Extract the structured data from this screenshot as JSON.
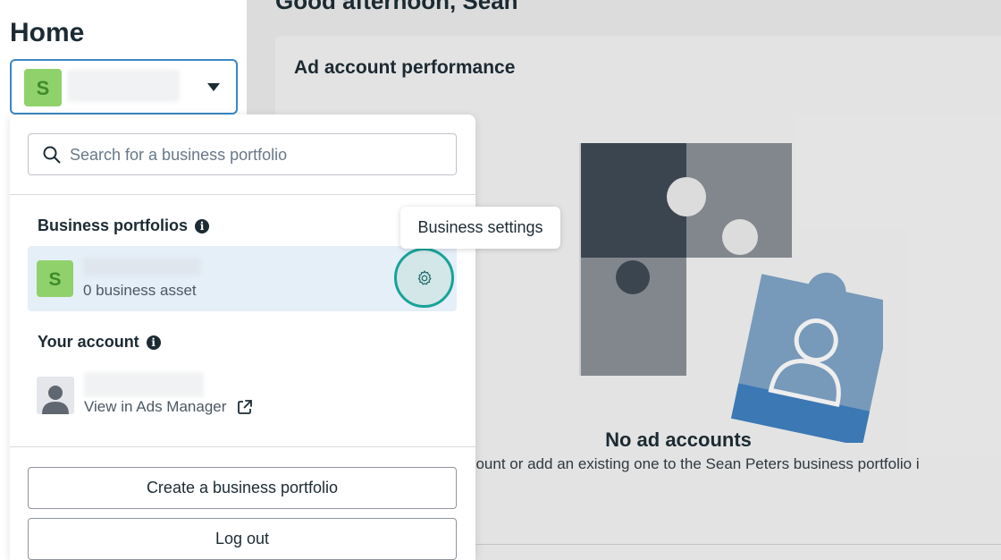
{
  "sidebar": {
    "title": "Home",
    "selected_portfolio_initial": "S"
  },
  "main": {
    "greeting": "Good afternoon, Sean",
    "card_title": "Ad account performance",
    "empty_title": "No ad accounts",
    "empty_description": "account or add an existing one to the Sean Peters business portfolio i"
  },
  "dropdown": {
    "search_placeholder": "Search for a business portfolio",
    "business_portfolios_label": "Business portfolios",
    "portfolio": {
      "initial": "S",
      "asset_count": "0 business asset"
    },
    "your_account_label": "Your account",
    "view_in_ads_manager": "View in Ads Manager",
    "create_button": "Create a business portfolio",
    "logout_button": "Log out"
  },
  "tooltip": {
    "text": "Business settings"
  },
  "colors": {
    "avatar_green": "#8fd16b",
    "avatar_letter": "#3f8a2a",
    "accent_teal": "#18a39a",
    "select_border": "#3b87c4"
  },
  "icons": {
    "search": "search-icon",
    "caret": "chevron-down-icon",
    "info": "info-icon",
    "settings": "gear-icon",
    "external_link": "external-link-icon",
    "avatar": "person-avatar-icon"
  }
}
